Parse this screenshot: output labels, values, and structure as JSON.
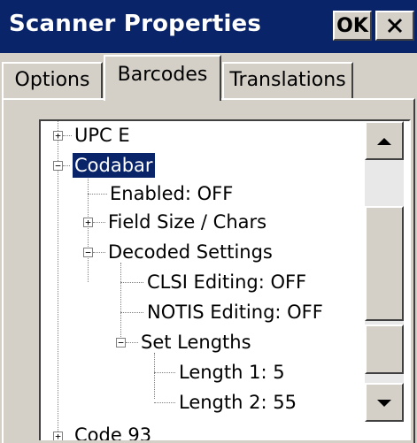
{
  "window": {
    "title": "Scanner Properties",
    "ok_label": "OK",
    "close_label": "×"
  },
  "tabs": [
    {
      "label": "Options",
      "active": false
    },
    {
      "label": "Barcodes",
      "active": true
    },
    {
      "label": "Translations",
      "active": false
    }
  ],
  "tree": {
    "nodes": [
      {
        "label": "UPC E",
        "expander": "+"
      },
      {
        "label": "Codabar",
        "expander": "−",
        "selected": true
      },
      {
        "label": "Enabled: OFF"
      },
      {
        "label": "Field Size / Chars",
        "expander": "+"
      },
      {
        "label": "Decoded Settings",
        "expander": "−"
      },
      {
        "label": "CLSI Editing: OFF"
      },
      {
        "label": "NOTIS Editing: OFF"
      },
      {
        "label": "Set Lengths",
        "expander": "−"
      },
      {
        "label": "Length 1: 5"
      },
      {
        "label": "Length 2: 55"
      },
      {
        "label": "Code 93",
        "expander": "+"
      }
    ]
  },
  "colors": {
    "titlebar": "#0a246a",
    "selection": "#0a246a",
    "face": "#d4d0c8"
  },
  "icons": {
    "close": "close-icon",
    "scroll_up": "arrow-up-icon",
    "scroll_down": "arrow-down-icon",
    "expand": "plus-box-icon",
    "collapse": "minus-box-icon"
  }
}
